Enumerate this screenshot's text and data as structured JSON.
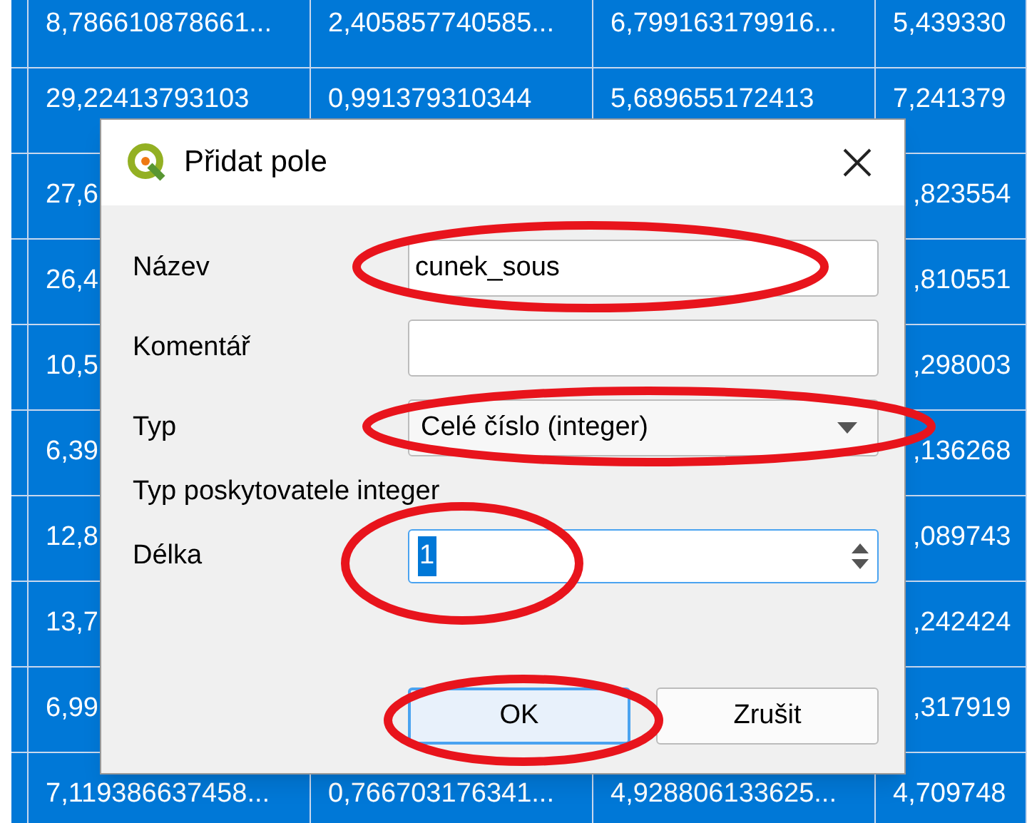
{
  "table": {
    "rows": [
      {
        "cells": [
          "8,786610878661...",
          "2,405857740585...",
          "6,799163179916...",
          "5,439330"
        ]
      },
      {
        "cells": [
          "29,22413793103",
          "0,991379310344",
          "5,689655172413",
          "7,241379"
        ]
      },
      {
        "cells": [
          "27,6",
          "",
          "",
          ",823554"
        ]
      },
      {
        "cells": [
          "26,4",
          "",
          "",
          ",810551"
        ]
      },
      {
        "cells": [
          "10,5",
          "",
          "",
          ",298003"
        ]
      },
      {
        "cells": [
          "6,39",
          "",
          "",
          ",136268"
        ]
      },
      {
        "cells": [
          "12,8",
          "",
          "",
          ",089743"
        ]
      },
      {
        "cells": [
          "13,7",
          "",
          "",
          ",242424"
        ]
      },
      {
        "cells": [
          "6,99",
          "",
          "",
          ",317919"
        ]
      },
      {
        "cells": [
          "7,119386637458...",
          "0,766703176341...",
          "4,928806133625...",
          "4,709748"
        ]
      }
    ]
  },
  "dialog": {
    "title": "Přidat pole",
    "fields": [
      {
        "kind": "text",
        "label": "Název",
        "value": "cunek_sous"
      },
      {
        "kind": "text",
        "label": "Komentář"
      },
      {
        "kind": "combo",
        "label": "Typ",
        "value": "Celé číslo (integer)"
      },
      {
        "kind": "info",
        "label": "Typ poskytovatele",
        "value": "integer"
      },
      {
        "kind": "spin",
        "label": "Délka",
        "value": "1"
      }
    ],
    "buttons": [
      {
        "label": "OK",
        "default": true
      },
      {
        "label": "Zrušit",
        "default": false
      }
    ]
  }
}
